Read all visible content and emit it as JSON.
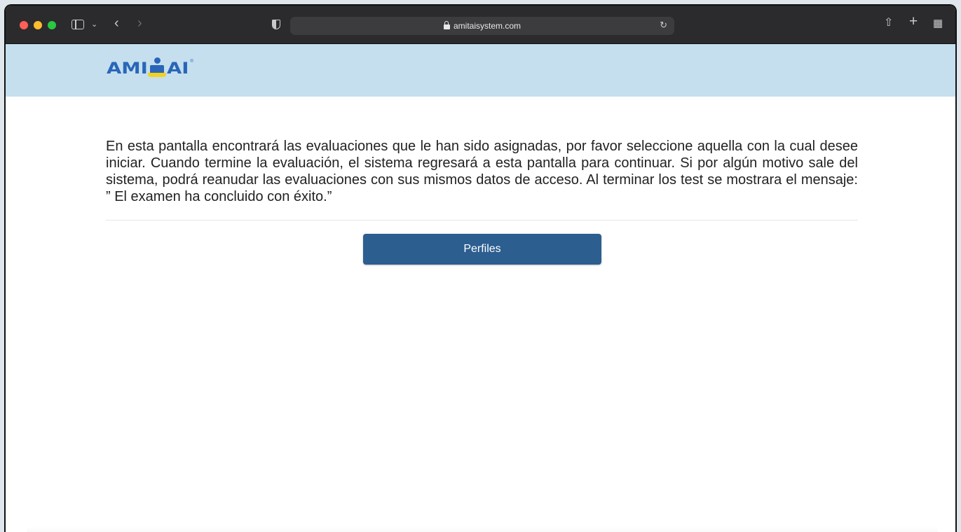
{
  "browser": {
    "url": "amitaisystem.com",
    "icons": [
      "sidebar-icon",
      "chevron-down-icon",
      "back-icon",
      "forward-icon",
      "shield-icon",
      "lock-icon",
      "reload-icon",
      "share-icon",
      "plus-icon",
      "tabs-overview-icon"
    ]
  },
  "header": {
    "logo_text_left": "AMI",
    "logo_text_right": "AI",
    "logo_reg": "®",
    "background_color": "#c5dfee"
  },
  "main": {
    "instructions": "En esta pantalla encontrará las evaluaciones que le han sido asignadas, por favor seleccione aquella con la cual desee iniciar. Cuando termine la evaluación, el sistema regresará a esta pantalla para continuar. Si por algún motivo sale del sistema, podrá reanudar las evaluaciones con sus mismos datos de acceso. Al terminar los test se mostrara el mensaje: ” El examen ha concluido con éxito.”",
    "button_label": "Perfiles",
    "button_color": "#2c5e90"
  }
}
